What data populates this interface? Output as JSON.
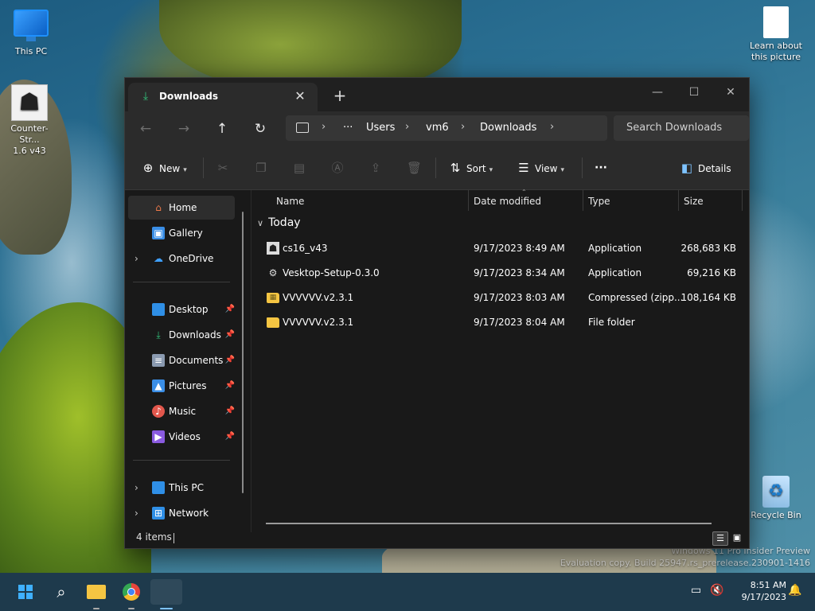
{
  "desktop": {
    "icons": {
      "this_pc": "This PC",
      "counter_strike_line1": "Counter-Str...",
      "counter_strike_line2": "1.6 v43",
      "learn_line1": "Learn about",
      "learn_line2": "this picture",
      "recycle_bin": "Recycle Bin"
    },
    "watermark": {
      "line1": "Windows 11 Pro Insider Preview",
      "line2": "Evaluation copy. Build 25947.rs_prerelease.230901-1416"
    }
  },
  "window": {
    "tab_title": "Downloads",
    "controls": {
      "minimize": "—",
      "maximize": "☐",
      "close": "✕"
    }
  },
  "address": {
    "ellipsis": "···",
    "segments": [
      "Users",
      "vm6",
      "Downloads"
    ]
  },
  "search": {
    "placeholder": "Search Downloads"
  },
  "commands": {
    "new": "New",
    "sort": "Sort",
    "view": "View",
    "more": "···",
    "details": "Details"
  },
  "sidebar": {
    "home": "Home",
    "gallery": "Gallery",
    "onedrive": "OneDrive",
    "pinned": [
      "Desktop",
      "Downloads",
      "Documents",
      "Pictures",
      "Music",
      "Videos"
    ],
    "this_pc": "This PC",
    "network": "Network"
  },
  "columns": {
    "name": "Name",
    "date": "Date modified",
    "type": "Type",
    "size": "Size"
  },
  "group": {
    "label": "Today"
  },
  "files": [
    {
      "name": "cs16_v43",
      "date": "9/17/2023 8:49 AM",
      "type": "Application",
      "size": "268,683 KB"
    },
    {
      "name": "Vesktop-Setup-0.3.0",
      "date": "9/17/2023 8:34 AM",
      "type": "Application",
      "size": "69,216 KB"
    },
    {
      "name": "VVVVVV.v2.3.1",
      "date": "9/17/2023 8:03 AM",
      "type": "Compressed (zipp...",
      "size": "108,164 KB"
    },
    {
      "name": "VVVVVV.v2.3.1",
      "date": "9/17/2023 8:04 AM",
      "type": "File folder",
      "size": ""
    }
  ],
  "status": {
    "count": "4 items"
  },
  "taskbar": {
    "time": "8:51 AM",
    "date": "9/17/2023"
  },
  "colors": {
    "window_bg": "#191919",
    "bar_bg": "#2b2b2b",
    "accent": "#3fb0ff",
    "folder": "#f5c542",
    "download_green": "#33c07a"
  }
}
